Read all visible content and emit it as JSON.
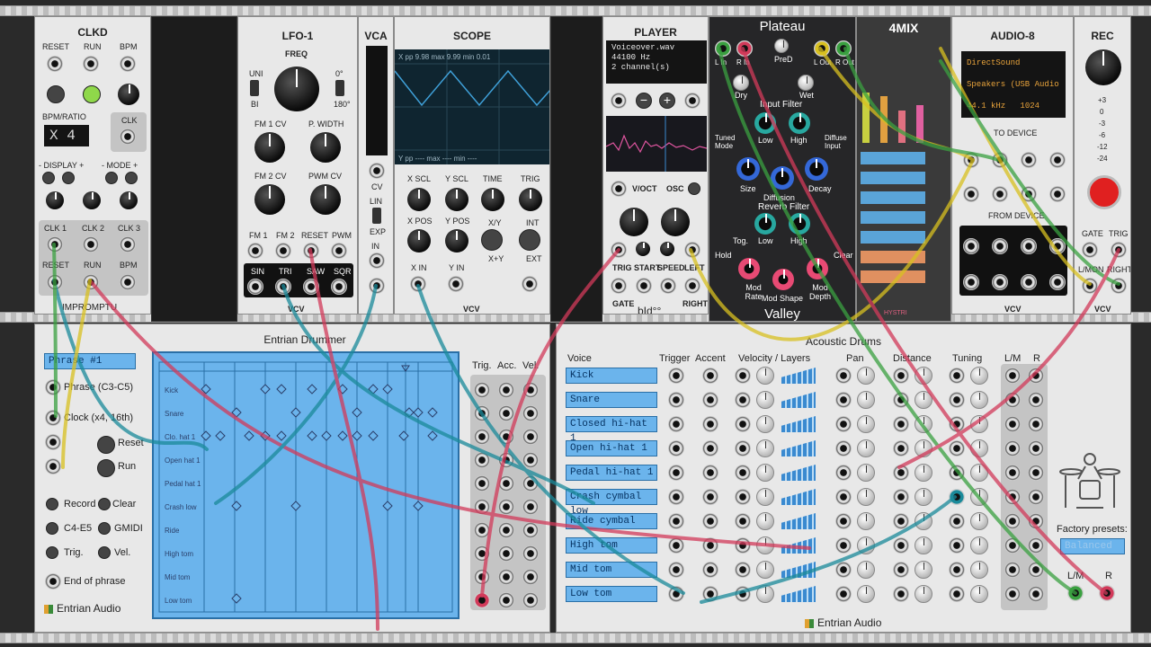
{
  "modules": {
    "clkd": {
      "title": "CLKD",
      "reset": "RESET",
      "run": "RUN",
      "bpm": "BPM",
      "bpm_ratio": "BPM/RATIO",
      "ratio_display": "X 4",
      "clk": "CLK",
      "display": "- DISPLAY +",
      "mode": "- MODE +",
      "clk1": "CLK 1",
      "clk2": "CLK 2",
      "clk3": "CLK 3",
      "reset2": "RESET",
      "run2": "RUN",
      "bpm2": "BPM",
      "brand": "IMPROMPTU"
    },
    "lfo": {
      "title": "LFO-1",
      "freq": "FREQ",
      "uni": "UNI",
      "bi": "BI",
      "deg0": "0°",
      "deg180": "180°",
      "fm1cv": "FM 1 CV",
      "pwidth": "P. WIDTH",
      "fm2cv": "FM 2 CV",
      "pwmcv": "PWM CV",
      "fm1": "FM 1",
      "fm2": "FM 2",
      "reset": "RESET",
      "pwm": "PWM",
      "sin": "SIN",
      "tri": "TRI",
      "saw": "SAW",
      "sqr": "SQR",
      "brand": "VCV"
    },
    "vca": {
      "title": "VCA",
      "cv": "CV",
      "lin": "LIN",
      "exp": "EXP",
      "in": "IN"
    },
    "scope": {
      "title": "SCOPE",
      "readout": "X  pp  9.98   max  9.99  min  0.01",
      "readout2": "Y  pp  ----  max  ----  min  ----",
      "xscl": "X SCL",
      "yscl": "Y SCL",
      "time": "TIME",
      "trig": "TRIG",
      "xpos": "X POS",
      "ypos": "Y POS",
      "xy": "X/Y",
      "xpy": "X+Y",
      "int": "INT",
      "ext": "EXT",
      "xin": "X IN",
      "yin": "Y IN",
      "brand": "VCV"
    },
    "player": {
      "title": "PLAYER",
      "file": "Voiceover.wav",
      "rate": "44100 Hz",
      "channels": "2 channel(s)",
      "voct": "V/OCT",
      "osc": "OSC",
      "trig": "TRIG",
      "start": "START",
      "speed": "SPEED",
      "left": "LEFT",
      "gate": "GATE",
      "right": "RIGHT",
      "brand": "bId°°"
    },
    "plateau": {
      "title": "Plateau",
      "footer": "Valley",
      "lin": "L In",
      "rin": "R In",
      "lout": "L Out",
      "rout": "R Out",
      "dry": "Dry",
      "wet": "Wet",
      "pred": "PreD",
      "input_filter": "Input Filter",
      "tuned": "Tuned Mode",
      "low": "Low",
      "high": "High",
      "diffuse": "Diffuse Input",
      "size": "Size",
      "decay": "Decay",
      "diffusion": "Diffusion",
      "reverb_filter": "Reverb Filter",
      "tog": "Tog.",
      "hold": "Hold",
      "clear": "Clear",
      "mod_rate": "Mod Rate",
      "mod_shape": "Mod Shape",
      "mod_depth": "Mod Depth"
    },
    "mix": {
      "title": "4MIX",
      "brand": "HYSTRI"
    },
    "audio": {
      "title": "AUDIO-8",
      "driver": "DirectSound",
      "device": "Speakers (USB Audio",
      "rate": "44.1 kHz",
      "block": "1024",
      "to_device": "TO DEVICE",
      "from_device": "FROM DEVICE",
      "brand": "VCV"
    },
    "rec": {
      "title": "REC",
      "levels": [
        "+3",
        "0",
        "-3",
        "-6",
        "-12",
        "-24"
      ],
      "gate": "GATE",
      "trig": "TRIG",
      "lmon": "L/MON",
      "right": "RIGHT",
      "brand": "VCV"
    },
    "drummer": {
      "title": "Entrian Drummer",
      "phrase_value": "Phrase #1",
      "phrase": "Phrase (C3-C5)",
      "clock": "Clock (x4, 16th)",
      "reset": "Reset",
      "run": "Run",
      "record": "Record",
      "clear": "Clear",
      "c4e5": "C4-E5",
      "gmidi": "GMIDI",
      "trig": "Trig.",
      "vel": "Vel.",
      "end": "End of phrase",
      "brand": "Entrian Audio",
      "col_trig": "Trig.",
      "col_acc": "Acc.",
      "col_vel": "Vel.",
      "rows": [
        "Kick",
        "Snare",
        "Clo. hat 1",
        "Open hat 1",
        "Pedal hat 1",
        "Crash low",
        "Ride",
        "High tom",
        "Mid tom",
        "Low tom"
      ]
    },
    "acoustic": {
      "title": "Acoustic Drums",
      "voice": "Voice",
      "trigger": "Trigger",
      "accent": "Accent",
      "velocity": "Velocity / Layers",
      "pan": "Pan",
      "distance": "Distance",
      "tuning": "Tuning",
      "lm": "L/M",
      "r": "R",
      "voices": [
        "Kick",
        "Snare",
        "Closed hi-hat 1",
        "Open hi-hat 1",
        "Pedal hi-hat 1",
        "Crash cymbal low",
        "Ride cymbal",
        "High tom",
        "Mid tom",
        "Low tom"
      ],
      "factory": "Factory presets:",
      "preset": "Balanced",
      "out_lm": "L/M",
      "out_r": "R",
      "brand": "Entrian Audio"
    }
  },
  "colors": {
    "accent_blue": "#6bb4ec",
    "cable_red": "#d23a5a",
    "cable_green": "#3aa040",
    "cable_yellow": "#d8c020",
    "cable_teal": "#1a8a9a"
  }
}
